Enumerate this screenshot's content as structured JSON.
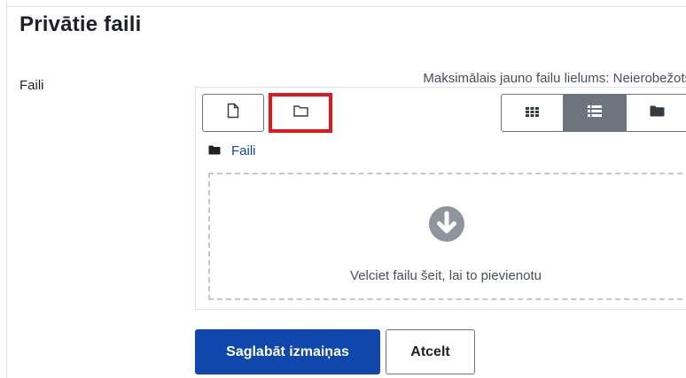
{
  "page": {
    "title": "Privātie faili"
  },
  "form": {
    "field_label": "Faili",
    "max_size_text": "Maksimālais jauno failu lielums: Neierobežots"
  },
  "filemanager": {
    "toolbar": {
      "add_file_icon": "file-icon",
      "create_folder_icon": "folder-outline-icon",
      "view_icons_icon": "grid-icon",
      "view_list_icon": "list-icon",
      "view_tree_icon": "folder-icon",
      "active_view": "list",
      "highlight_color": "#e0171c"
    },
    "path": {
      "current": "Faili"
    },
    "dropzone": {
      "text": "Velciet failu šeit, lai to pievienotu",
      "icon": "download-circle-icon"
    }
  },
  "buttons": {
    "save": "Saglabāt izmaiņas",
    "cancel": "Atcelt"
  },
  "colors": {
    "primary": "#0f47ad",
    "active_view": "#6c757d"
  }
}
